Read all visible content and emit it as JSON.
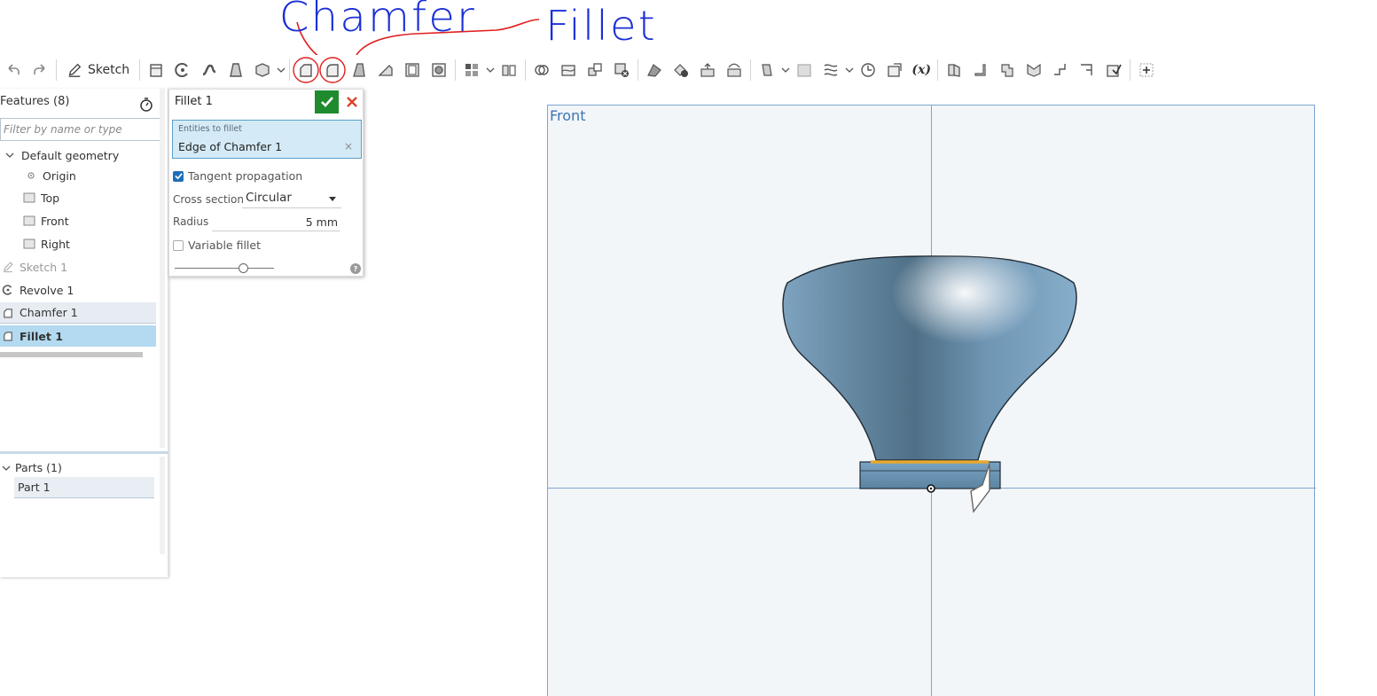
{
  "annotations": {
    "chamfer_label": "Chamfer",
    "fillet_label": "Fillet",
    "ink_color": "#1a2fd6",
    "circle_color": "#e02020"
  },
  "toolbar": {
    "sketch_label": "Sketch",
    "variable_label": "(x)"
  },
  "features": {
    "title": "Features (8)",
    "filter_placeholder": "Filter by name or type",
    "default_geometry": "Default geometry",
    "items": [
      {
        "label": "Origin"
      },
      {
        "label": "Top"
      },
      {
        "label": "Front"
      },
      {
        "label": "Right"
      },
      {
        "label": "Sketch 1"
      },
      {
        "label": "Revolve 1"
      },
      {
        "label": "Chamfer 1"
      },
      {
        "label": "Fillet 1"
      }
    ],
    "parts_title": "Parts (1)",
    "part_item": "Part 1"
  },
  "dialog": {
    "title": "Fillet 1",
    "entities_label": "Entities to fillet",
    "entities_value": "Edge of Chamfer 1",
    "entities_clear": "×",
    "tangent_label": "Tangent propagation",
    "cross_section_label": "Cross section",
    "cross_section_value": "Circular",
    "radius_label": "Radius",
    "radius_value": "5 mm",
    "variable_label": "Variable fillet",
    "help": "?"
  },
  "viewport": {
    "plane_label": "Front",
    "model_color": "#5f88a6",
    "highlight_edge_color": "#e8a82c"
  }
}
